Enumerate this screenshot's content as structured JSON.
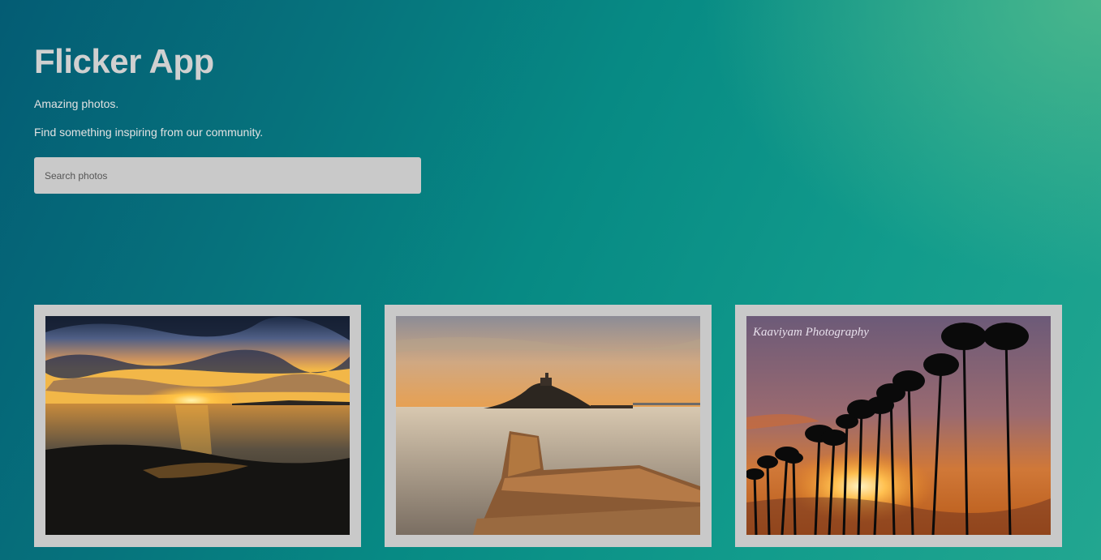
{
  "header": {
    "title": "Flicker App",
    "tagline": "Amazing photos.",
    "subtitle": "Find something inspiring from our community."
  },
  "search": {
    "placeholder": "Search photos",
    "value": ""
  },
  "photos": [
    {
      "name": "beach-sunset-photo",
      "description": "sunset over ocean beach"
    },
    {
      "name": "island-castle-photo",
      "description": "island with castle and stone pier at dusk"
    },
    {
      "name": "palm-trees-sunset-photo",
      "description": "palm tree silhouettes at sunset",
      "watermark": "Kaaviyam Photography"
    }
  ],
  "colors": {
    "background_start": "#045c74",
    "background_end": "#22a690",
    "card_frame": "#c9c9c9",
    "title_text": "#d0d0d0"
  }
}
